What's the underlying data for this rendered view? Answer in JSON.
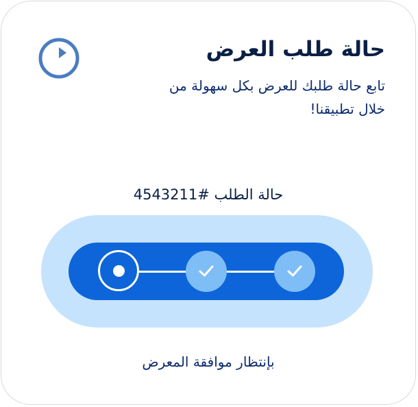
{
  "card": {
    "title": "حالة طلب العرض",
    "subtitle": "تابع حالة طلبك للعرض بكل سهولة من خلال تطبيقنا!",
    "clock_icon": "clock-icon"
  },
  "tracker": {
    "order_label": "حالة الطلب #4543211",
    "steps": [
      {
        "state": "current",
        "icon": "radio-dot-icon"
      },
      {
        "state": "done",
        "icon": "check-icon"
      },
      {
        "state": "done",
        "icon": "check-icon"
      }
    ],
    "status_text": "بإنتظار موافقة المعرض"
  },
  "colors": {
    "accent": "#0d65d9",
    "accent_light": "#c5e3fd",
    "step_done": "#7fbdf6",
    "title": "#0a1f44",
    "icon_stroke": "#4a7cc0"
  }
}
